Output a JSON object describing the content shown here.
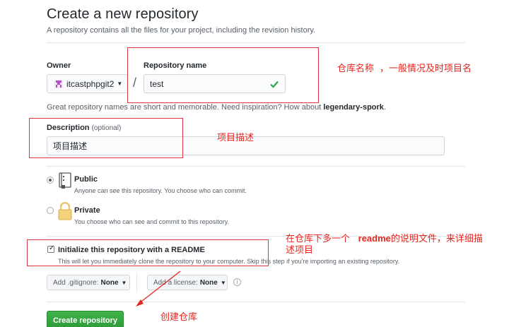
{
  "header": {
    "title": "Create a new repository",
    "subtitle": "A repository contains all the files for your project, including the revision history."
  },
  "owner": {
    "label": "Owner",
    "value": "itcastphpgit2"
  },
  "repo": {
    "label": "Repository name",
    "value": "test",
    "slash": "/"
  },
  "hint": {
    "text": "Great repository names are short and memorable. Need inspiration? How about",
    "suggestion": "legendary-spork",
    "end": "."
  },
  "description": {
    "label": "Description",
    "optional": "(optional)",
    "value": "项目描述"
  },
  "visibility": {
    "public_title": "Public",
    "public_desc": "Anyone can see this repository. You choose who can commit.",
    "private_title": "Private",
    "private_desc": "You choose who can see and commit to this repository.",
    "selected": "Public"
  },
  "init": {
    "title": "Initialize this repository with a README",
    "desc": "This will let you immediately clone the repository to your computer. Skip this step if you're importing an existing repository.",
    "checked": true
  },
  "gitignore": {
    "prefix": "Add .gitignore:",
    "value": "None"
  },
  "license": {
    "prefix": "Add a license:",
    "value": "None"
  },
  "submit": {
    "label": "Create repository"
  },
  "annotations": {
    "repo_name": "仓库名称",
    "repo_name_note": "，一般情况及时项目名",
    "description": "项目描述",
    "readme_line1_a": "在仓库下多一个",
    "readme_line1_b": "readme",
    "readme_line1_c": "的说明文件，来详细描",
    "readme_line2": "述项目",
    "create": "创建仓库"
  },
  "colors": {
    "annotation_red": "#e5251f",
    "button_green": "#2c9a39",
    "check_green": "#28a745"
  }
}
